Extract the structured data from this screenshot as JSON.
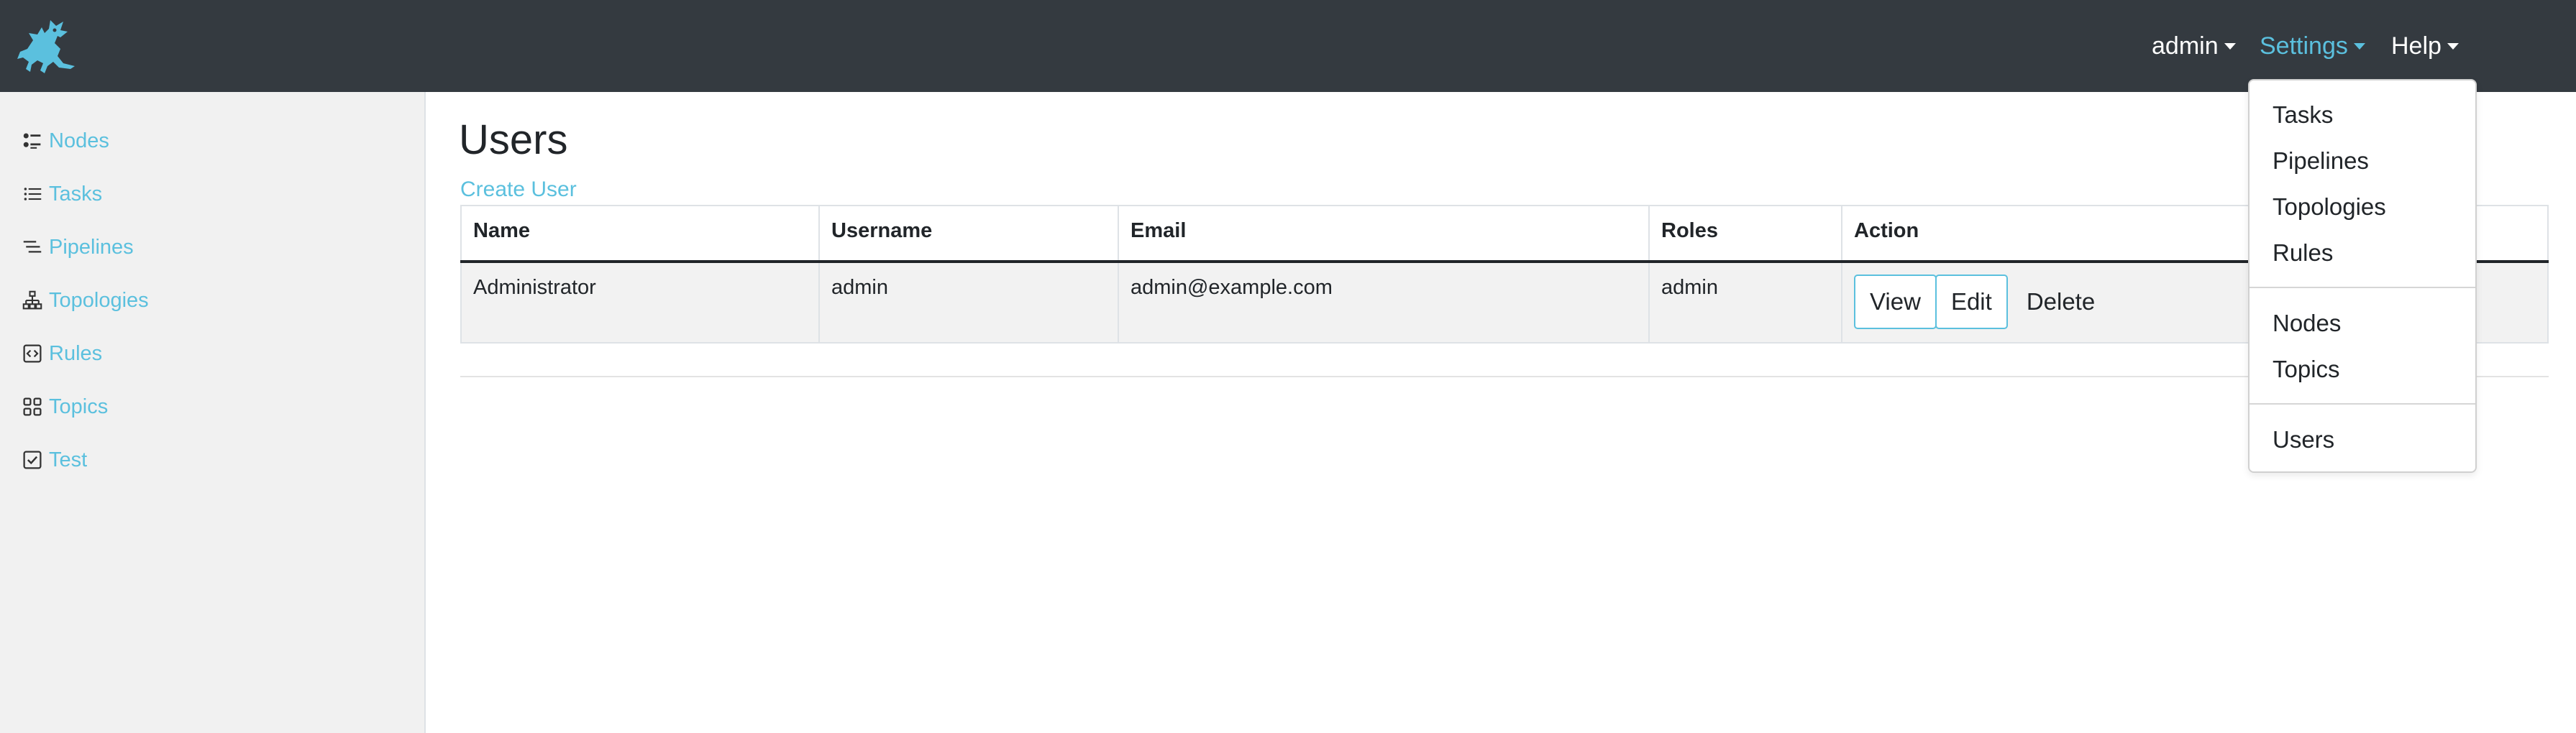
{
  "navbar": {
    "user_label": "admin",
    "settings_label": "Settings",
    "help_label": "Help"
  },
  "sidebar": {
    "items": [
      {
        "label": "Nodes",
        "icon": "nodes-icon"
      },
      {
        "label": "Tasks",
        "icon": "list-icon"
      },
      {
        "label": "Pipelines",
        "icon": "pipelines-icon"
      },
      {
        "label": "Topologies",
        "icon": "topology-icon"
      },
      {
        "label": "Rules",
        "icon": "code-square-icon"
      },
      {
        "label": "Topics",
        "icon": "grid-icon"
      },
      {
        "label": "Test",
        "icon": "check-square-icon"
      }
    ]
  },
  "main": {
    "title": "Users",
    "create_label": "Create User",
    "table": {
      "headers": [
        "Name",
        "Username",
        "Email",
        "Roles",
        "Action"
      ],
      "rows": [
        {
          "name": "Administrator",
          "username": "admin",
          "email": "admin@example.com",
          "roles": "admin",
          "actions": {
            "view": "View",
            "edit": "Edit",
            "delete": "Delete"
          }
        }
      ]
    }
  },
  "settings_menu": {
    "group1": [
      "Tasks",
      "Pipelines",
      "Topologies",
      "Rules"
    ],
    "group2": [
      "Nodes",
      "Topics"
    ],
    "group3": [
      "Users"
    ]
  },
  "colors": {
    "navbar_bg": "#343a40",
    "accent": "#5bc0de",
    "sidebar_bg": "#f1f1f1"
  }
}
